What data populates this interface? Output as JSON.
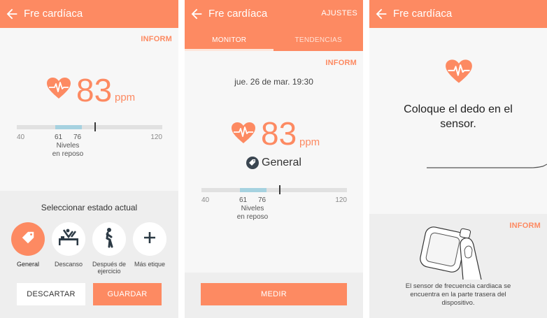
{
  "colors": {
    "accent": "#fd8a62",
    "range_bar": "#a6d2e0",
    "panel": "#eeeeee"
  },
  "screen1": {
    "title": "Fre cardíaca",
    "inform": "INFORM",
    "bpm": "83",
    "unit": "ppm",
    "scale": {
      "min": "40",
      "max": "120",
      "low": "61",
      "high": "76",
      "caption_line1": "Niveles",
      "caption_line2": "en reposo"
    },
    "select_title": "Seleccionar estado actual",
    "states": [
      {
        "label": "General",
        "icon": "tag-icon"
      },
      {
        "label": "Descanso",
        "icon": "resting-person-icon"
      },
      {
        "label_line1": "Después de",
        "label_line2": "ejercicio",
        "icon": "post-exercise-person-icon"
      },
      {
        "label": "Más etique",
        "icon": "plus-icon"
      }
    ],
    "discard": "DESCARTAR",
    "save": "GUARDAR"
  },
  "screen2": {
    "title": "Fre cardíaca",
    "settings": "AJUSTES",
    "tabs": [
      "MONITOR",
      "TENDENCIAS"
    ],
    "inform": "INFORM",
    "date": "jue. 26 de mar. 19:30",
    "bpm": "83",
    "unit": "ppm",
    "tag": "General",
    "scale": {
      "min": "40",
      "max": "120",
      "low": "61",
      "high": "76",
      "caption_line1": "Niveles",
      "caption_line2": "en reposo"
    },
    "measure": "MEDIR"
  },
  "screen3": {
    "title": "Fre cardíaca",
    "instruction_line1": "Coloque el dedo en el",
    "instruction_line2": "sensor.",
    "inform": "INFORM",
    "sensor_text_line1": "El sensor de frecuencia cardiaca se",
    "sensor_text_line2": "encuentra en la parte trasera del",
    "sensor_text_line3": "dispositivo."
  }
}
